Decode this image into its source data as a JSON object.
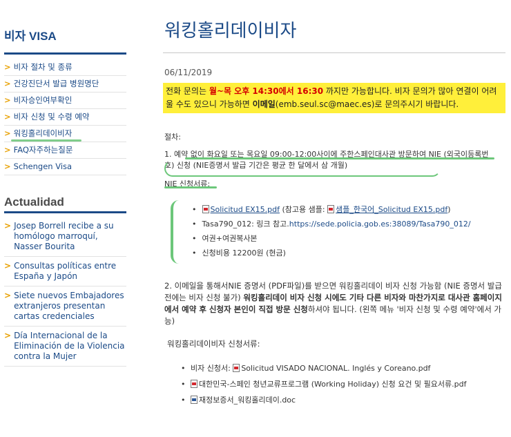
{
  "sidebar": {
    "visa_title": "비자 VISA",
    "visa_items": [
      {
        "label": "비자 절차 및 종류"
      },
      {
        "label": "건강진단서 발급 병원명단"
      },
      {
        "label": "비자승인여부확인"
      },
      {
        "label": "비자 신청 및 수령 예약"
      },
      {
        "label": "워킹홀리데이비자"
      },
      {
        "label": "FAQ자주하는질문"
      },
      {
        "label": "Schengen Visa"
      }
    ],
    "actualidad_title": "Actualidad",
    "actualidad_items": [
      {
        "label": "Josep Borrell recibe a su homólogo marroquí, Nasser Bourita"
      },
      {
        "label": "Consultas políticas entre España y Japón"
      },
      {
        "label": "Siete nuevos Embajadores extranjeros presentan cartas credenciales"
      },
      {
        "label": "Día Internacional de la Eliminación de la Violencia contra la Mujer"
      }
    ]
  },
  "main": {
    "title": "워킹홀리데이비자",
    "date": "06/11/2019",
    "notice": {
      "p1": "전화 문의는 ",
      "hours1": "월~목 오후 14:30에서 16:30",
      "p2": " 까지만 가능합니다. 비자 문의가 많아 연결이 어려울 수도 있으니 가능하면 ",
      "email_label": "이메일",
      "p3": "(emb.seul.sc@maec.es)로 문의주시기 바랍니다."
    },
    "procedure_label": "절차:",
    "step1": "1.    예약 없이 화요일 또는 목요일 09:00-12:00사이에 주한스페인대사관 방문하여 NIE (외국이등록번호) 신청 (NIE증명서 발급 기간은 평균 한 달에서 삼 개월)",
    "nie_docs_label": "NIE 신청서류:",
    "nie_docs": {
      "item1_link": "Solicitud EX15.pdf",
      "item1_mid": " (참고용 샘플: ",
      "item1_link2": "샘플_한국어_Solicitud EX15.pdf",
      "item1_end": ")",
      "item2_text": "Tasa790_012: 링크 참고.",
      "item2_url": "https://sede.policia.gob.es:38089/Tasa790_012/",
      "item3": "여권+여권복사본",
      "item4": "신청비용 12200원 (현금)"
    },
    "step2": {
      "a": "2.    이메일을 통해서NIE 증명서 (PDF파일)를 받으면 워킹홀리데이 비자 신청 가능함 (NIE 증명서 발급 전에는 비자 신청 불가) ",
      "b": "워킹홀리데이 비자 신청 시에도 기타 다른 비자와 마찬가지로 대사관 홈페이지에서 예약 후 신청자 본인이 직접 방문 신청",
      "c": "하셔야 됩니다. (왼쪽 메뉴 '비자 신청 및 수령 예약'에서 가능)"
    },
    "wh_docs_label": "워킹홀리데이비자 신청서류:",
    "wh_docs": [
      {
        "prefix": "  비자 신청서: ",
        "link": "Solicitud VISADO NACIONAL. Inglés y Coreano.pdf",
        "icon": "pdf-icon"
      },
      {
        "prefix": "",
        "link": "대한민국-스페인 청년교류프로그램 (Working Holiday) 신청 요건 및 필요서류.pdf",
        "icon": "pdf-icon"
      },
      {
        "prefix": "",
        "link": "재정보증서_워킹홀리데이.doc",
        "icon": "word-icon"
      }
    ]
  }
}
